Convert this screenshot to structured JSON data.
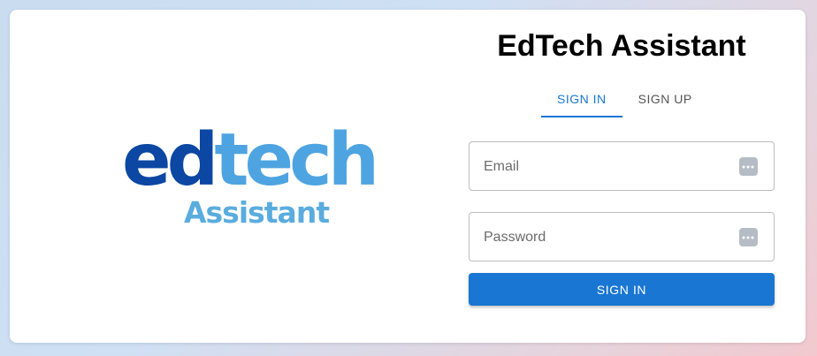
{
  "logo": {
    "word_part1": "ed",
    "word_part2": "tech",
    "subtitle": "Assistant"
  },
  "header": {
    "title": "EdTech Assistant"
  },
  "tabs": [
    {
      "label": "SIGN IN",
      "active": true
    },
    {
      "label": "SIGN UP",
      "active": false
    }
  ],
  "form": {
    "email": {
      "placeholder": "Email",
      "value": ""
    },
    "password": {
      "placeholder": "Password",
      "value": ""
    },
    "submit_label": "SIGN IN"
  },
  "colors": {
    "primary": "#1976d2",
    "logo_dark_blue": "#0b47a3",
    "logo_light_blue": "#4ea4e0"
  },
  "icons": {
    "field_icon": "password-manager-dots-icon"
  }
}
